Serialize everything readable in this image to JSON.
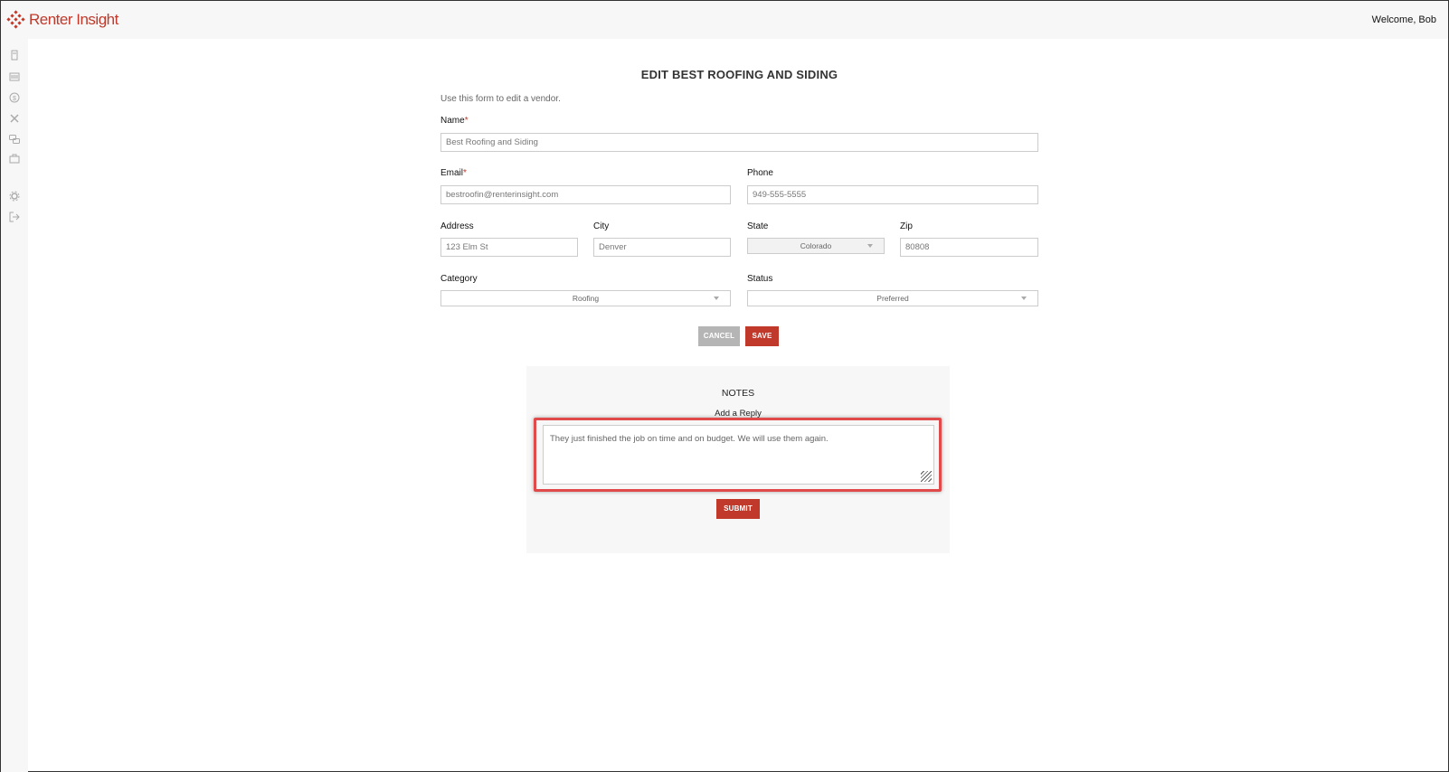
{
  "header": {
    "brand": "Renter Insight",
    "welcome": "Welcome, Bob"
  },
  "sidebar": {
    "icons": [
      "calculator-icon",
      "list-icon",
      "dollar-icon",
      "tools-icon",
      "chat-icon",
      "briefcase-icon",
      "gear-icon",
      "logout-icon"
    ]
  },
  "form": {
    "title": "EDIT BEST ROOFING AND SIDING",
    "subtitle": "Use this form to edit a vendor.",
    "name_label": "Name",
    "name_value": "Best Roofing and Siding",
    "email_label": "Email",
    "email_value": "bestroofin@renterinsight.com",
    "phone_label": "Phone",
    "phone_value": "949-555-5555",
    "address_label": "Address",
    "address_value": "123 Elm St",
    "city_label": "City",
    "city_value": "Denver",
    "state_label": "State",
    "state_value": "Colorado",
    "zip_label": "Zip",
    "zip_value": "80808",
    "category_label": "Category",
    "category_value": "Roofing",
    "status_label": "Status",
    "status_value": "Preferred",
    "required_mark": "*",
    "cancel_label": "CANCEL",
    "save_label": "SAVE"
  },
  "notes": {
    "title": "NOTES",
    "reply_label": "Add a Reply",
    "reply_text": "They just finished the job on time and on budget.  We will use them again.",
    "submit_label": "SUBMIT"
  },
  "colors": {
    "accent": "#c0392b",
    "highlight": "#e04a4a",
    "panel": "#f7f7f7"
  }
}
